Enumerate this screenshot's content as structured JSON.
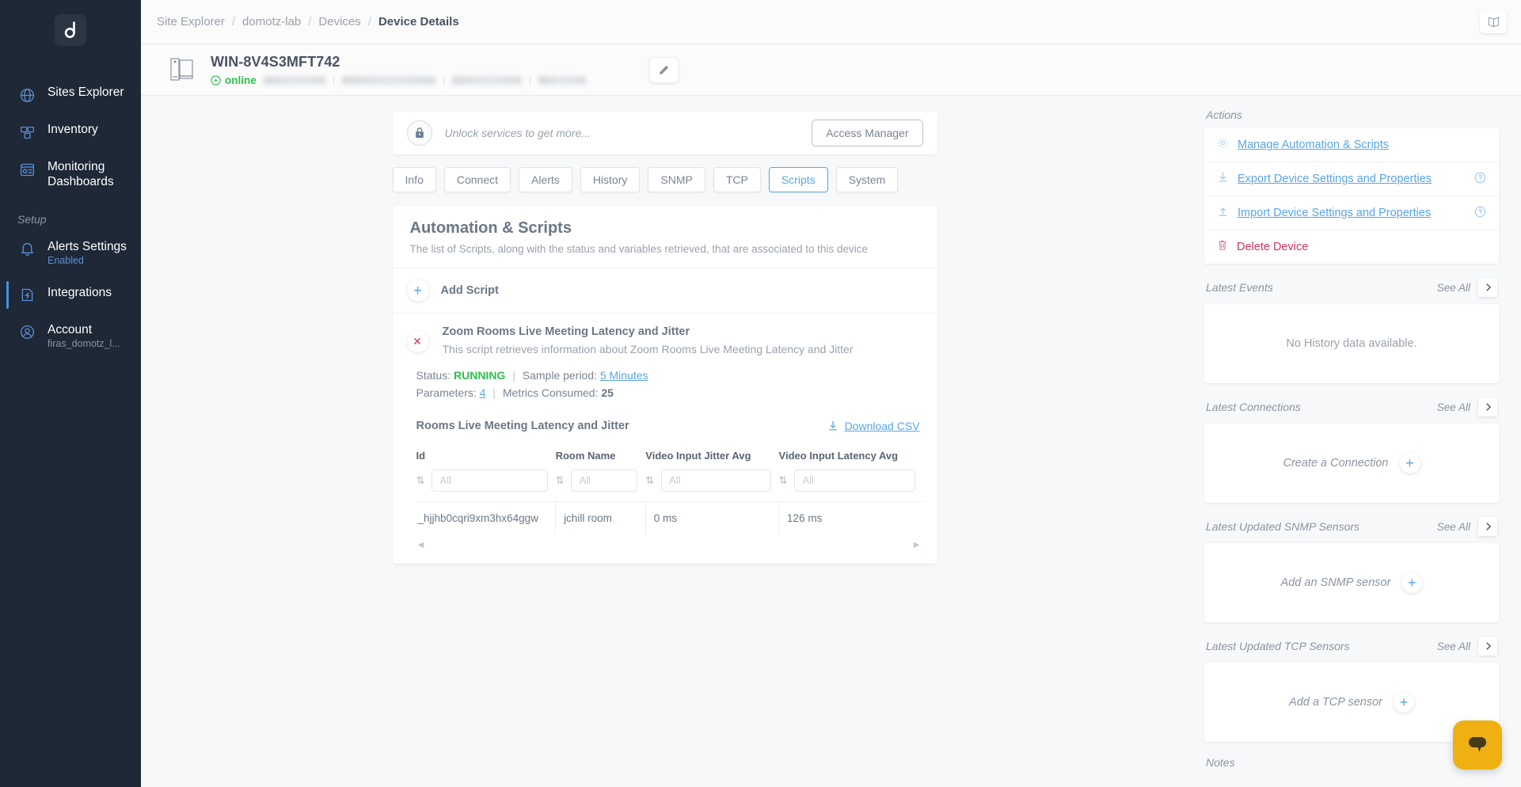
{
  "sidebar": {
    "logo_icon": "domotz-logo-icon",
    "items": [
      {
        "label": "Sites Explorer",
        "icon": "globe-icon",
        "sub": ""
      },
      {
        "label": "Inventory",
        "icon": "boxes-icon",
        "sub": ""
      },
      {
        "label": "Monitoring Dashboards",
        "icon": "dashboard-icon",
        "sub": ""
      }
    ],
    "setup_label": "Setup",
    "setup_items": [
      {
        "label": "Alerts Settings",
        "icon": "bell-icon",
        "sub": "Enabled",
        "active": false
      },
      {
        "label": "Integrations",
        "icon": "plug-icon",
        "sub": "",
        "active": true
      },
      {
        "label": "Account",
        "icon": "user-circle-icon",
        "sub": "firas_domotz_l...",
        "active": false
      }
    ]
  },
  "topbar": {
    "breadcrumb": [
      "Site Explorer",
      "domotz-lab",
      "Devices",
      "Device Details"
    ],
    "separator": "/",
    "book_icon": "open-book-icon"
  },
  "device": {
    "name": "WIN-8V4S3MFT742",
    "status": "online",
    "device_icon": "computer-icon",
    "edit_icon": "pencil-icon"
  },
  "unlock": {
    "icon": "lock-icon",
    "message": "Unlock services to get more...",
    "button": "Access Manager"
  },
  "tabs": [
    {
      "label": "Info",
      "active": false
    },
    {
      "label": "Connect",
      "active": false
    },
    {
      "label": "Alerts",
      "active": false
    },
    {
      "label": "History",
      "active": false
    },
    {
      "label": "SNMP",
      "active": false
    },
    {
      "label": "TCP",
      "active": false
    },
    {
      "label": "Scripts",
      "active": true
    },
    {
      "label": "System",
      "active": false
    }
  ],
  "automation": {
    "title": "Automation & Scripts",
    "subtitle": "The list of Scripts, along with the status and variables retrieved, that are associated to this device",
    "add_script_label": "Add Script",
    "add_script_icon": "plus-icon",
    "script": {
      "remove_icon": "close-x-icon",
      "name": "Zoom Rooms Live Meeting Latency and Jitter",
      "description": "This script retrieves information about Zoom Rooms Live Meeting Latency and Jitter",
      "status_label": "Status:",
      "status_value": "RUNNING",
      "sample_period_label": "Sample period:",
      "sample_period_value": "5 Minutes",
      "parameters_label": "Parameters:",
      "parameters_value": "4",
      "metrics_label": "Metrics Consumed:",
      "metrics_value": "25",
      "divider": "|"
    }
  },
  "table": {
    "title": "Rooms Live Meeting Latency and Jitter",
    "download_label": "Download CSV",
    "download_icon": "download-arrow-icon",
    "sort_icon": "sort-updown-icon",
    "filter_placeholder": "All",
    "columns": [
      "Id",
      "Room Name",
      "Video Input Jitter Avg",
      "Video Input Latency Avg"
    ],
    "rows": [
      [
        "_hjjhb0cqri9xm3hx64ggw",
        "jchill room",
        "0 ms",
        "126 ms"
      ]
    ]
  },
  "rail": {
    "actions_label": "Actions",
    "actions": [
      {
        "label": "Manage Automation & Scripts",
        "icon": "gear-icon",
        "help": false,
        "danger": false
      },
      {
        "label": "Export Device Settings and Properties",
        "icon": "download-arrow-icon",
        "help": true,
        "danger": false
      },
      {
        "label": "Import Device Settings and Properties",
        "icon": "upload-arrow-icon",
        "help": true,
        "danger": false
      },
      {
        "label": "Delete Device",
        "icon": "trash-icon",
        "help": false,
        "danger": true
      }
    ],
    "help_icon": "question-circle-icon",
    "see_all": "See All",
    "chevron_icon": "chevron-right-icon",
    "events": {
      "title": "Latest Events",
      "empty": "No History data available."
    },
    "connections": {
      "title": "Latest Connections",
      "cta": "Create a Connection",
      "cta_icon": "plus-icon"
    },
    "snmp": {
      "title": "Latest Updated SNMP Sensors",
      "cta": "Add an SNMP sensor",
      "cta_icon": "plus-icon"
    },
    "tcp": {
      "title": "Latest Updated TCP Sensors",
      "cta": "Add a TCP sensor",
      "cta_icon": "plus-icon"
    },
    "notes_label": "Notes"
  },
  "chat": {
    "icon": "chat-bubble-icon",
    "color": "#eeb111"
  },
  "colors": {
    "accent": "#5aa5e6",
    "sidebar_bg": "#1e2836",
    "status_online": "#2fbf4f",
    "danger": "#d0365c",
    "page_bg": "#f7f8f9"
  }
}
